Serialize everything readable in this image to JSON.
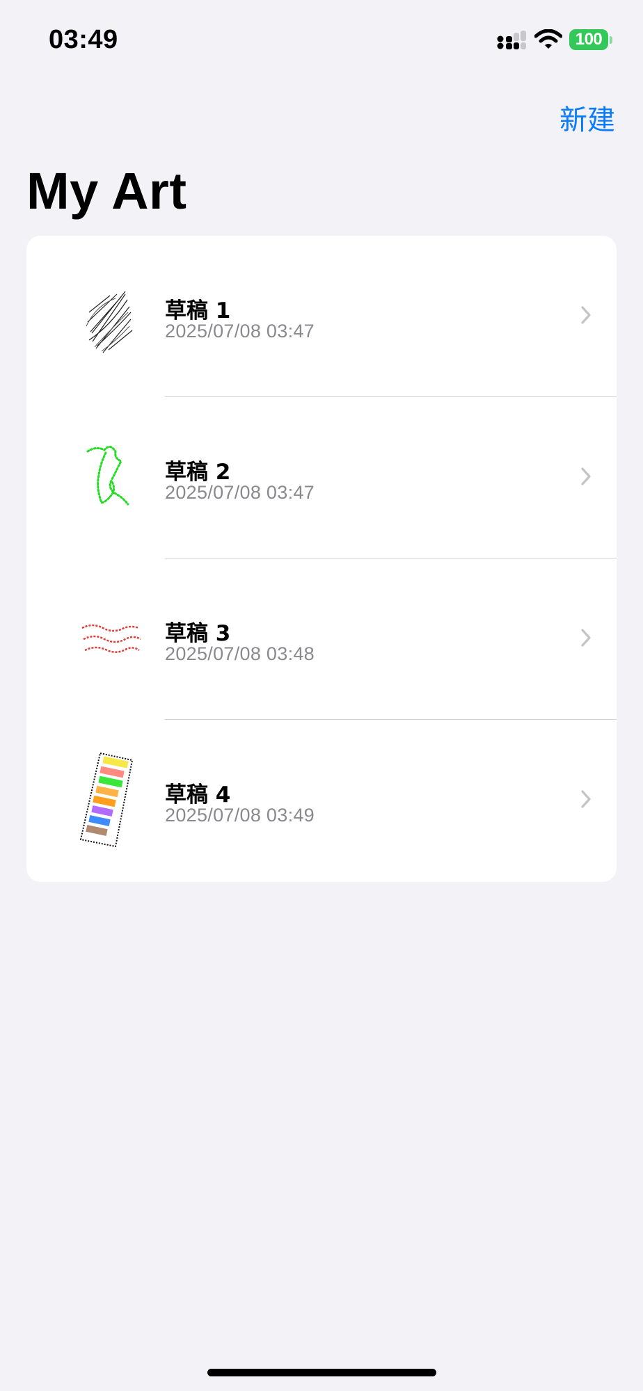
{
  "status_bar": {
    "time": "03:49",
    "battery_level": "100",
    "icons": [
      "signal-icon",
      "wifi-icon",
      "battery-icon"
    ],
    "battery_color": "#34c759"
  },
  "nav": {
    "new_label": "新建",
    "accent_color": "#0a7aff"
  },
  "page": {
    "title": "My Art"
  },
  "drafts": [
    {
      "title": "草稿 1",
      "date": "2025/07/08 03:47",
      "thumbnail": "black scribble sketch"
    },
    {
      "title": "草稿 2",
      "date": "2025/07/08 03:47",
      "thumbnail": "green dotted line sketch"
    },
    {
      "title": "草稿 3",
      "date": "2025/07/08 03:48",
      "thumbnail": "red wavy lines sketch"
    },
    {
      "title": "草稿 4",
      "date": "2025/07/08 03:49",
      "thumbnail": "multicolor striped sketch"
    }
  ]
}
